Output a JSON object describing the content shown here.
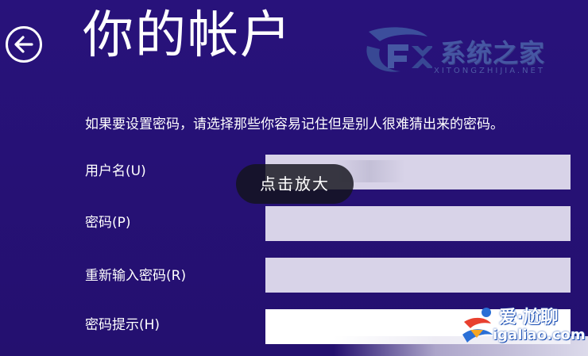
{
  "page": {
    "title": "你的帐户",
    "instruction": "如果要设置密码，请选择那些你容易记住但是别人很难猜出来的密码。"
  },
  "navigation": {
    "back_icon": "arrow-left-circle-icon"
  },
  "form": {
    "fields": [
      {
        "label": "用户名(U)",
        "value": "",
        "placeholder": ""
      },
      {
        "label": "密码(P)",
        "value": "",
        "placeholder": ""
      },
      {
        "label": "重新输入密码(R)",
        "value": "",
        "placeholder": ""
      },
      {
        "label": "密码提示(H)",
        "value": "",
        "placeholder": ""
      }
    ]
  },
  "overlay": {
    "zoom_tooltip": "点击放大"
  },
  "watermarks": {
    "top_logo_text": "系统之家",
    "top_logo_subtext": "XITONGZHIJIA.NET",
    "corner_title": "爱·尬聊",
    "corner_domain": "igaliao.com"
  },
  "colors": {
    "background": "#26117a",
    "input_fill": "#d8d3e8",
    "text": "#ffffff"
  }
}
